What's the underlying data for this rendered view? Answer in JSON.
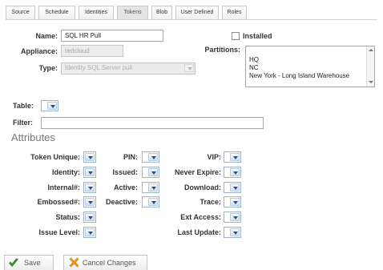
{
  "tabs": [
    {
      "label": "Source"
    },
    {
      "label": "Schedule"
    },
    {
      "label": "Identities"
    },
    {
      "label": "Tokens"
    },
    {
      "label": "Blob"
    },
    {
      "label": "User Defined"
    },
    {
      "label": "Roles"
    }
  ],
  "active_tab": "Tokens",
  "form": {
    "name_label": "Name:",
    "name_value": "SQL HR Pull",
    "appliance_label": "Appliance:",
    "appliance_value": "redcloud",
    "type_label": "Type:",
    "type_value": "Identity SQL Server pull",
    "installed_label": "Installed",
    "partitions_label": "Partitions:",
    "partitions": [
      "HQ",
      "NC",
      "New York - Long Island Warehouse"
    ],
    "table_label": "Table:",
    "filter_label": "Filter:",
    "filter_value": ""
  },
  "attributes": {
    "title": "Attributes",
    "col1": [
      "Token Unique:",
      "Identity:",
      "Internal#:",
      "Embossed#:",
      "Status:",
      "Issue Level:"
    ],
    "col2": [
      "PIN:",
      "Issued:",
      "Active:",
      "Deactive:"
    ],
    "col3": [
      "VIP:",
      "Never Expire:",
      "Download:",
      "Trace:",
      "Ext Access:",
      "Last Update:"
    ]
  },
  "buttons": {
    "save_label": "Save",
    "cancel_label": "Cancel Changes"
  },
  "icons": {
    "save": "checkmark-icon",
    "cancel": "cancel-x-icon"
  },
  "colors": {
    "save_icon": "#3a9a2a",
    "cancel_icon": "#f0a020"
  }
}
